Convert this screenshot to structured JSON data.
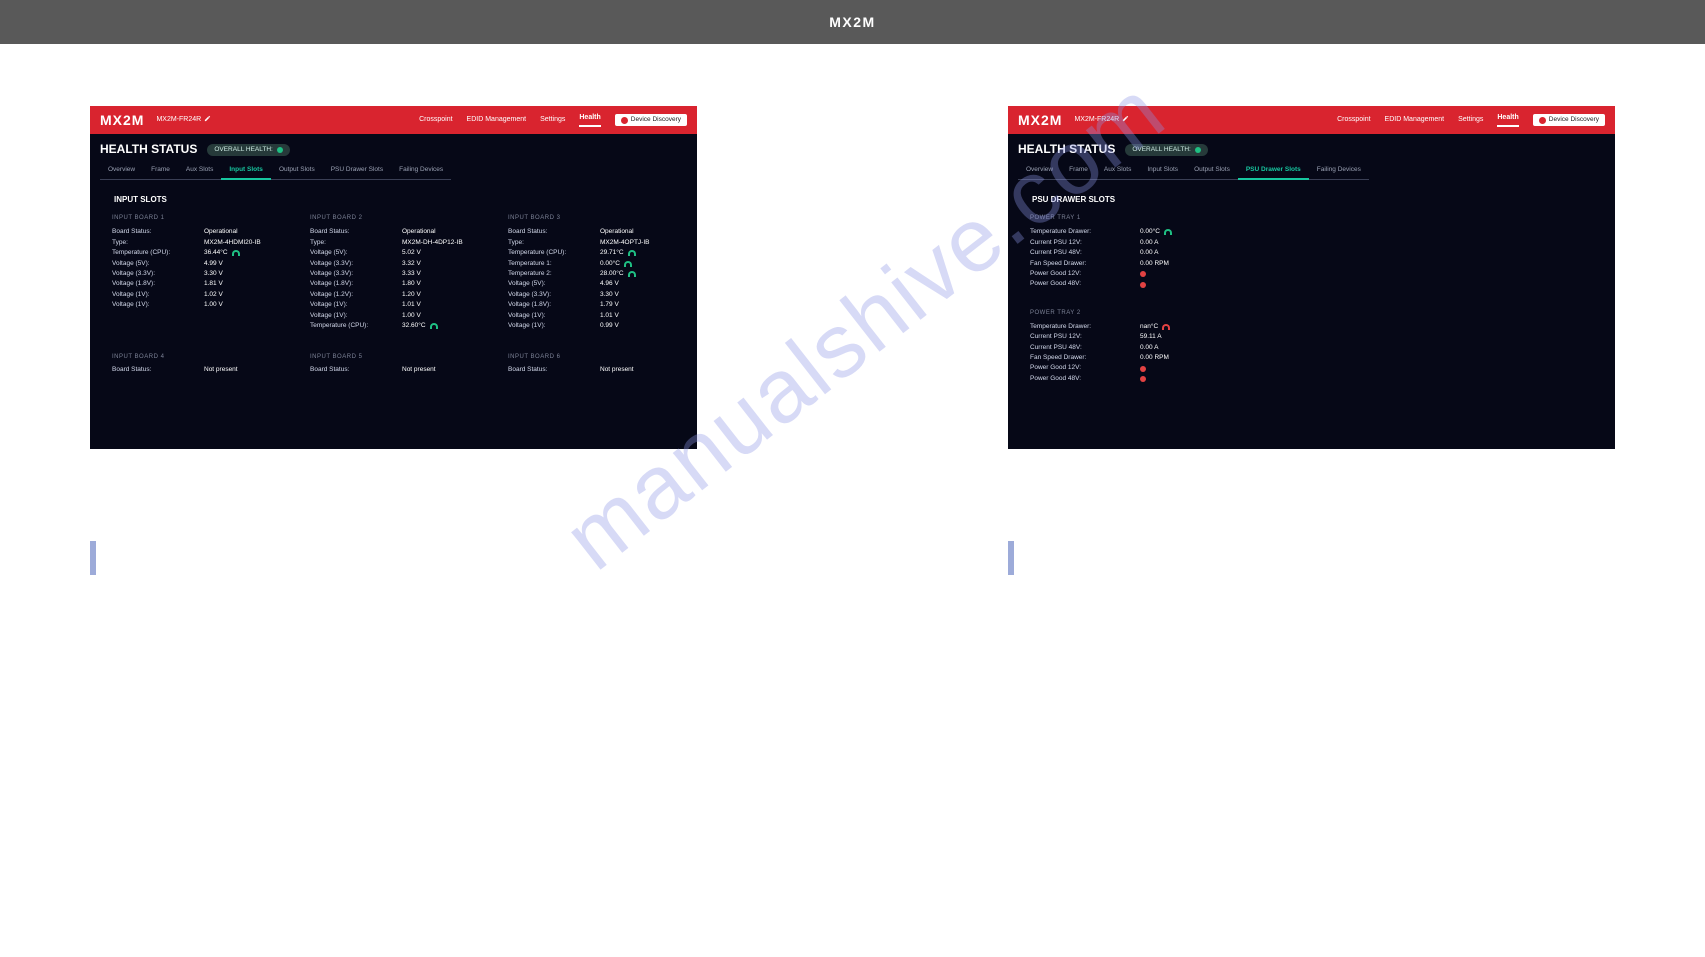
{
  "top_logo": "MX2M",
  "watermark": "manualshive.com",
  "panels": {
    "left": {
      "device": "MX2M-FR24R",
      "nav": [
        "Crosspoint",
        "EDID Management",
        "Settings",
        "Health"
      ],
      "nav_active": 3,
      "device_discovery": "Device Discovery",
      "health_status": "HEALTH STATUS",
      "overall": "OVERALL HEALTH:",
      "tabs": [
        "Overview",
        "Frame",
        "Aux Slots",
        "Input Slots",
        "Output Slots",
        "PSU Drawer Slots",
        "Failing Devices"
      ],
      "active_tab": 3,
      "section": "INPUT SLOTS",
      "boards": [
        {
          "head": "INPUT BOARD 1",
          "rows": [
            {
              "k": "Board Status:",
              "v": "Operational"
            },
            {
              "k": "Type:",
              "v": "MX2M-4HDMI20-IB"
            },
            {
              "k": "Temperature (CPU):",
              "v": "36.44°C",
              "g": "g"
            },
            {
              "k": "Voltage (5V):",
              "v": "4.99 V"
            },
            {
              "k": "Voltage (3.3V):",
              "v": "3.30 V"
            },
            {
              "k": "Voltage (1.8V):",
              "v": "1.81 V"
            },
            {
              "k": "Voltage (1V):",
              "v": "1.02 V"
            },
            {
              "k": "Voltage (1V):",
              "v": "1.00 V"
            }
          ]
        },
        {
          "head": "INPUT BOARD 2",
          "rows": [
            {
              "k": "Board Status:",
              "v": "Operational"
            },
            {
              "k": "Type:",
              "v": "MX2M-DH-4DP12-IB"
            },
            {
              "k": "Voltage (5V):",
              "v": "5.02 V"
            },
            {
              "k": "Voltage (3.3V):",
              "v": "3.32 V"
            },
            {
              "k": "Voltage (3.3V):",
              "v": "3.33 V"
            },
            {
              "k": "Voltage (1.8V):",
              "v": "1.80 V"
            },
            {
              "k": "Voltage (1.2V):",
              "v": "1.20 V"
            },
            {
              "k": "Voltage (1V):",
              "v": "1.01 V"
            },
            {
              "k": "Voltage (1V):",
              "v": "1.00 V"
            },
            {
              "k": "Temperature (CPU):",
              "v": "32.60°C",
              "g": "g"
            }
          ]
        },
        {
          "head": "INPUT BOARD 3",
          "rows": [
            {
              "k": "Board Status:",
              "v": "Operational"
            },
            {
              "k": "Type:",
              "v": "MX2M-4OPTJ-IB"
            },
            {
              "k": "Temperature (CPU):",
              "v": "29.71°C",
              "g": "g"
            },
            {
              "k": "Temperature 1:",
              "v": "0.00°C",
              "g": "g"
            },
            {
              "k": "Temperature 2:",
              "v": "28.00°C",
              "g": "g"
            },
            {
              "k": "Voltage (5V):",
              "v": "4.96 V"
            },
            {
              "k": "Voltage (3.3V):",
              "v": "3.30 V"
            },
            {
              "k": "Voltage (1.8V):",
              "v": "1.79 V"
            },
            {
              "k": "Voltage (1V):",
              "v": "1.01 V"
            },
            {
              "k": "Voltage (1V):",
              "v": "0.99 V"
            }
          ]
        }
      ],
      "boards2": [
        {
          "head": "INPUT BOARD 4",
          "rows": [
            {
              "k": "Board Status:",
              "v": "Not present"
            }
          ]
        },
        {
          "head": "INPUT BOARD 5",
          "rows": [
            {
              "k": "Board Status:",
              "v": "Not present"
            }
          ]
        },
        {
          "head": "INPUT BOARD 6",
          "rows": [
            {
              "k": "Board Status:",
              "v": "Not present"
            }
          ]
        }
      ]
    },
    "right": {
      "device": "MX2M-FR24R",
      "nav": [
        "Crosspoint",
        "EDID Management",
        "Settings",
        "Health"
      ],
      "nav_active": 3,
      "device_discovery": "Device Discovery",
      "health_status": "HEALTH STATUS",
      "overall": "OVERALL HEALTH:",
      "tabs": [
        "Overview",
        "Frame",
        "Aux Slots",
        "Input Slots",
        "Output Slots",
        "PSU Drawer Slots",
        "Failing Devices"
      ],
      "active_tab": 5,
      "section": "PSU DRAWER SLOTS",
      "trays": [
        {
          "head": "POWER TRAY 1",
          "rows": [
            {
              "k": "Temperature Drawer:",
              "v": "0.00°C",
              "g": "g"
            },
            {
              "k": "Current PSU 12V:",
              "v": "0.00 A"
            },
            {
              "k": "Current PSU 48V:",
              "v": "0.00 A"
            },
            {
              "k": "Fan Speed Drawer:",
              "v": "0.00 RPM"
            },
            {
              "k": "Power Good 12V:",
              "v": "",
              "led": "r"
            },
            {
              "k": "Power Good 48V:",
              "v": "",
              "led": "r"
            }
          ]
        },
        {
          "head": "POWER TRAY 2",
          "rows": [
            {
              "k": "Temperature Drawer:",
              "v": "nan°C",
              "g": "r"
            },
            {
              "k": "Current PSU 12V:",
              "v": "59.11 A"
            },
            {
              "k": "Current PSU 48V:",
              "v": "0.00 A"
            },
            {
              "k": "Fan Speed Drawer:",
              "v": "0.00 RPM"
            },
            {
              "k": "Power Good 12V:",
              "v": "",
              "led": "r"
            },
            {
              "k": "Power Good 48V:",
              "v": "",
              "led": "r"
            }
          ]
        }
      ]
    }
  }
}
